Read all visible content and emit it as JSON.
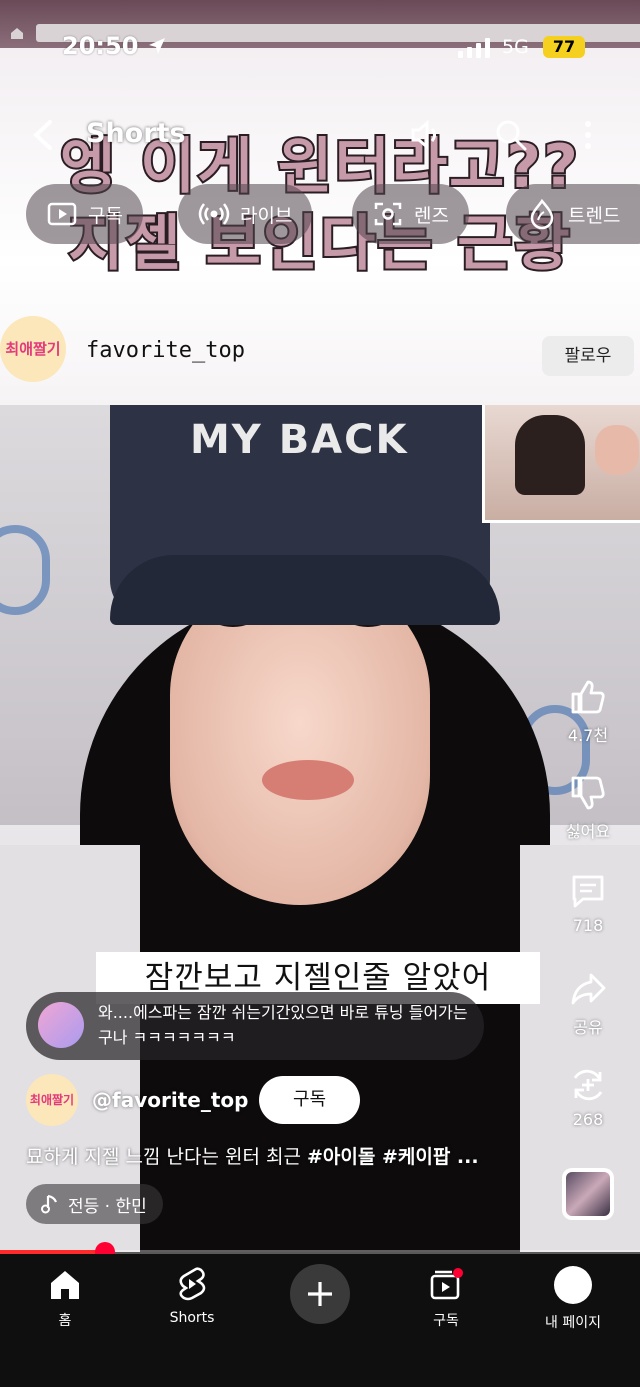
{
  "status_bar": {
    "time": "20:50",
    "network": "5G",
    "battery": "77"
  },
  "video_caption": {
    "line1": "엥 이게 윈터라고??",
    "line2": "지젤 보인다는 근황"
  },
  "header": {
    "title": "Shorts"
  },
  "chips": [
    {
      "label": "구독",
      "icon": "subscriptions-icon"
    },
    {
      "label": "라이브",
      "icon": "live-icon"
    },
    {
      "label": "렌즈",
      "icon": "lens-icon"
    },
    {
      "label": "트렌드",
      "icon": "trend-icon"
    }
  ],
  "in_video_channel": {
    "logo_text": "최애짤기",
    "name": "favorite_top",
    "follow_label": "팔로우"
  },
  "in_video_cap_text": "MY BACK",
  "in_video_subtitle": "잠깐보고 지젤인줄 알았어",
  "comment": {
    "text": "와....에스파는 잠깐 쉬는기간있으면 바로 튜닝 들어가는구나 ㅋㅋㅋㅋㅋㅋㅋ"
  },
  "rail": {
    "like_count": "4.7천",
    "dislike_label": "싫어요",
    "comment_count": "718",
    "share_label": "공유",
    "remix_count": "268"
  },
  "channel": {
    "logo_text": "최애짤기",
    "handle": "@favorite_top",
    "subscribe_label": "구독"
  },
  "description": {
    "text": "묘하게 지젤 느낌 난다는 윈터 최근 ",
    "tags": "#아이돌 #케이팝 ..."
  },
  "music": {
    "label": "전등 · 한민"
  },
  "progress": {
    "fraction": 0.164
  },
  "bottom_nav": {
    "home": "홈",
    "shorts": "Shorts",
    "subscriptions": "구독",
    "me": "내 페이지"
  },
  "colors": {
    "accent": "#ff0033",
    "caption_fill": "#c79aa9",
    "nav_bg": "#0f0f0f"
  }
}
